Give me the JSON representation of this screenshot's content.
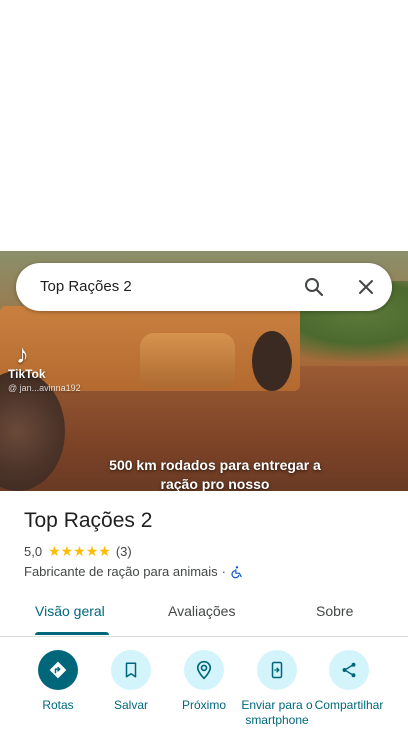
{
  "hero": {
    "watermark": "TikTok",
    "watermark_user": "@ jan...avinna192",
    "caption": "500 km rodados para entregar a ração pro nosso"
  },
  "search": {
    "query": "Top Rações 2"
  },
  "place": {
    "title": "Top Rações 2",
    "rating": "5,0",
    "stars": "★★★★★",
    "review_count": "(3)",
    "category": "Fabricante de ração para animais",
    "separator": "·"
  },
  "tabs": [
    {
      "label": "Visão geral"
    },
    {
      "label": "Avaliações"
    },
    {
      "label": "Sobre"
    }
  ],
  "actions": [
    {
      "label": "Rotas"
    },
    {
      "label": "Salvar"
    },
    {
      "label": "Próximo"
    },
    {
      "label": "Enviar para o smartphone"
    },
    {
      "label": "Compartilhar"
    }
  ],
  "colors": {
    "accent": "#00677b",
    "action_bg": "#d4f4fb",
    "star": "#fbbc04"
  },
  "icons": [
    "search-icon",
    "close-icon",
    "directions-icon",
    "bookmark-icon",
    "nearby-icon",
    "send-to-phone-icon",
    "share-icon",
    "wheelchair-icon"
  ]
}
